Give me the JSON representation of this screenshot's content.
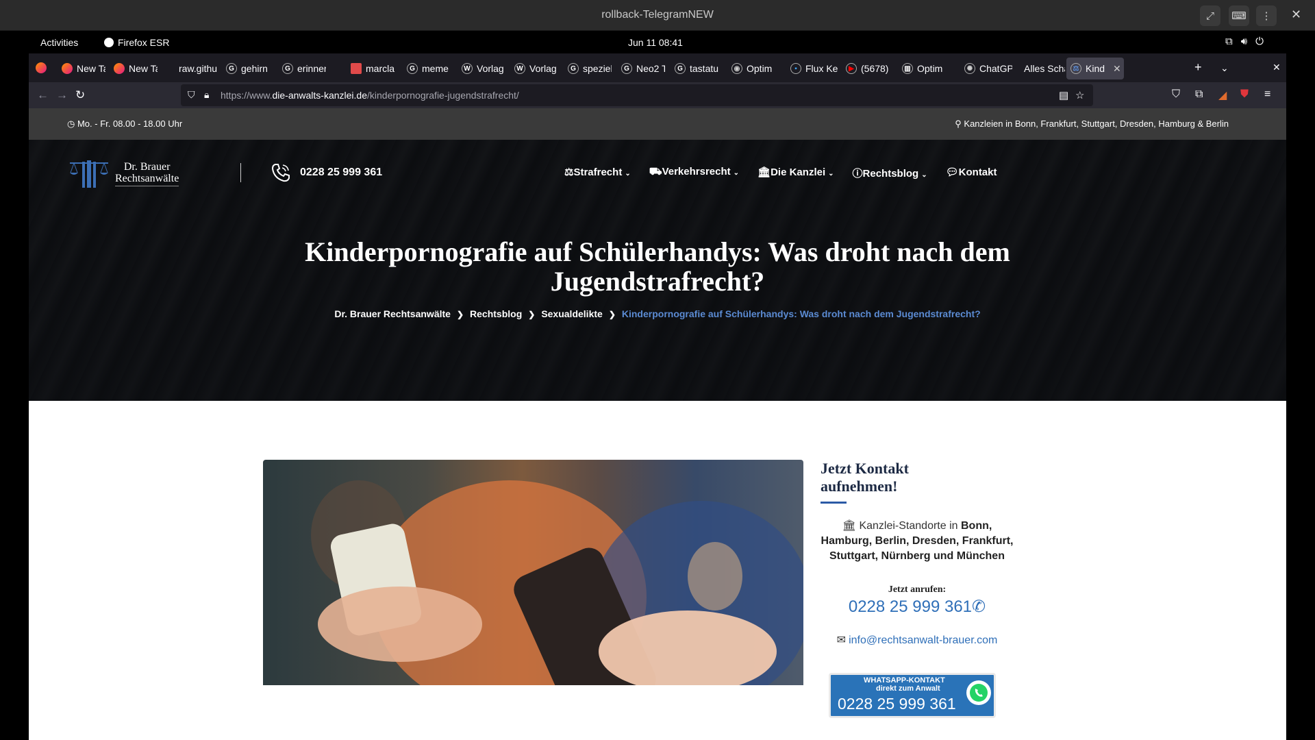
{
  "vm": {
    "title": "rollback-TelegramNEW"
  },
  "gnome": {
    "activities": "Activities",
    "app_name": "Firefox ESR",
    "clock": "Jun 11  08:41"
  },
  "tabs": [
    {
      "label": "New Ta",
      "favicon": "firefox",
      "color": "#ff7139"
    },
    {
      "label": "New Ta",
      "favicon": "firefox",
      "color": "#ff7139"
    },
    {
      "label": "raw.githu",
      "favicon": "none",
      "color": ""
    },
    {
      "label": "gehirn",
      "favicon": "google",
      "color": "#ffffff"
    },
    {
      "label": "erinner",
      "favicon": "google",
      "color": "#ffffff"
    },
    {
      "label": "marcla",
      "favicon": "image",
      "color": "#e04a4a"
    },
    {
      "label": "meme",
      "favicon": "google",
      "color": "#ffffff"
    },
    {
      "label": "Vorlag",
      "favicon": "wikipedia",
      "color": "#ffffff"
    },
    {
      "label": "Vorlag",
      "favicon": "wikipedia",
      "color": "#ffffff"
    },
    {
      "label": "speziel",
      "favicon": "google",
      "color": "#ffffff"
    },
    {
      "label": "Neo2 T",
      "favicon": "google",
      "color": "#ffffff"
    },
    {
      "label": "tastatu",
      "favicon": "google",
      "color": "#ffffff"
    },
    {
      "label": "Optim",
      "favicon": "eye",
      "color": "#cccccc"
    },
    {
      "label": "Flux Ke",
      "favicon": "flux",
      "color": "#3fa7ff"
    },
    {
      "label": "(5678)",
      "favicon": "youtube",
      "color": "#ff0000"
    },
    {
      "label": "Optim",
      "favicon": "chart",
      "color": "#ffffff"
    },
    {
      "label": "ChatGP",
      "favicon": "chatgpt",
      "color": "#cccccc"
    },
    {
      "label": "Alles Scha",
      "favicon": "none",
      "color": ""
    },
    {
      "label": "Kind",
      "favicon": "scales",
      "color": "#5b8bd3",
      "active": true
    }
  ],
  "urlbar": {
    "prefix": "https://www.",
    "domain": "die-anwalts-kanzlei.de",
    "path": "/kinderpornografie-jugendstrafrecht/"
  },
  "site": {
    "hours": "Mo. - Fr. 08.00 - 18.00 Uhr",
    "locations": "Kanzleien in Bonn, Frankfurt, Stuttgart, Dresden, Hamburg & Berlin",
    "logo_line1": "Dr. Brauer",
    "logo_line2": "Rechtsanwälte",
    "header_phone": "0228 25 999 361",
    "nav": [
      {
        "label": "Strafrecht",
        "icon": "scales-icon",
        "dropdown": true
      },
      {
        "label": "Verkehrsrecht",
        "icon": "car-icon",
        "dropdown": true
      },
      {
        "label": "Die Kanzlei",
        "icon": "building-icon",
        "dropdown": true
      },
      {
        "label": "Rechtsblog",
        "icon": "info-icon",
        "dropdown": true
      },
      {
        "label": "Kontakt",
        "icon": "chat-icon",
        "dropdown": false
      }
    ],
    "hero_title": "Kinderpornografie auf Schülerhandys: Was droht nach dem Jugendstrafrecht?",
    "breadcrumbs": [
      "Dr. Brauer Rechtsanwälte",
      "Rechtsblog",
      "Sexualdelikte",
      "Kinderpornografie auf Schülerhandys: Was droht nach dem Jugendstrafrecht?"
    ],
    "sidebar": {
      "title_line1": "Jetzt Kontakt",
      "title_line2": "aufnehmen!",
      "locations_prefix": "Kanzlei-Standorte in ",
      "locations_cities": "Bonn, Hamburg, Berlin, Dresden, Frankfurt, Stuttgart, Nürnberg und München",
      "call_label": "Jetzt anrufen:",
      "phone": "0228 25 999 361",
      "email": "info@rechtsanwalt-brauer.com",
      "whatsapp_line1": "WHATSAPP-KONTAKT",
      "whatsapp_line2": "direkt zum Anwalt",
      "whatsapp_phone": "0228 25 999 361"
    }
  },
  "colors": {
    "accent": "#2f6fb8",
    "breadcrumb_current": "#5b8bd3",
    "info_bar": "#3a3a3a"
  }
}
